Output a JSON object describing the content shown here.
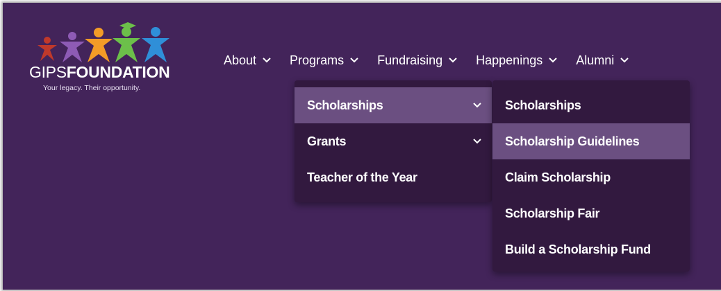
{
  "logo": {
    "word_light": "GIPS",
    "word_bold": "FOUNDATION",
    "tagline": "Your legacy. Their opportunity.",
    "figure_colors": [
      "#c0392b",
      "#8e5bb5",
      "#f39c27",
      "#6cc04a",
      "#2f8fd8"
    ]
  },
  "nav": {
    "items": [
      {
        "label": "About"
      },
      {
        "label": "Programs"
      },
      {
        "label": "Fundraising"
      },
      {
        "label": "Happenings"
      },
      {
        "label": "Alumni"
      }
    ]
  },
  "programs_menu": {
    "items": [
      {
        "label": "Scholarships",
        "has_submenu": true,
        "active": true
      },
      {
        "label": "Grants",
        "has_submenu": true,
        "active": false
      },
      {
        "label": "Teacher of the Year",
        "has_submenu": false,
        "active": false
      }
    ]
  },
  "scholarships_menu": {
    "items": [
      {
        "label": "Scholarships"
      },
      {
        "label": "Scholarship Guidelines",
        "active": true
      },
      {
        "label": "Claim Scholarship"
      },
      {
        "label": "Scholarship Fair"
      },
      {
        "label": "Build a Scholarship Fund"
      }
    ]
  },
  "colors": {
    "background": "#43245a",
    "menu_bg": "#32193f",
    "menu_active": "#6b4f81"
  }
}
